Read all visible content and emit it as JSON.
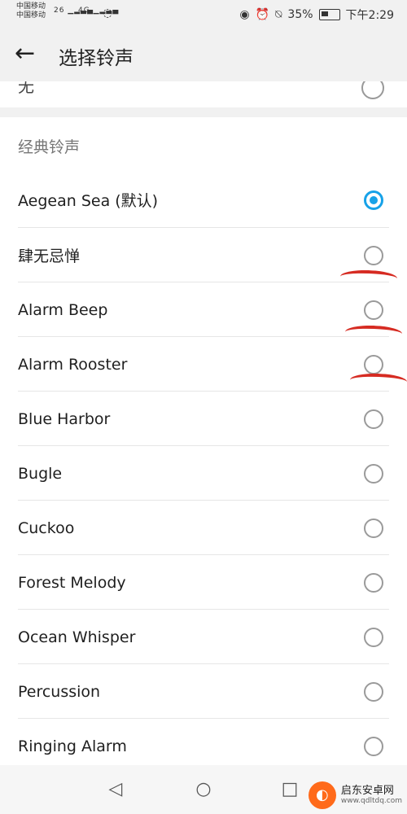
{
  "status": {
    "carrier1": "中国移动",
    "carrier2": "中国移动",
    "net1": "26",
    "net2": "4G",
    "battery": "35%",
    "time": "下午2:29"
  },
  "topbar": {
    "title": "选择铃声"
  },
  "none_option": {
    "label": "无"
  },
  "section": {
    "title": "经典铃声"
  },
  "ringtones": [
    {
      "label": "Aegean Sea (默认)",
      "selected": true
    },
    {
      "label": "肆无忌惮",
      "selected": false
    },
    {
      "label": "Alarm Beep",
      "selected": false
    },
    {
      "label": "Alarm Rooster",
      "selected": false
    },
    {
      "label": "Blue Harbor",
      "selected": false
    },
    {
      "label": "Bugle",
      "selected": false
    },
    {
      "label": "Cuckoo",
      "selected": false
    },
    {
      "label": "Forest Melody",
      "selected": false
    },
    {
      "label": "Ocean Whisper",
      "selected": false
    },
    {
      "label": "Percussion",
      "selected": false
    },
    {
      "label": "Ringing Alarm",
      "selected": false
    }
  ],
  "icons": {
    "back": "arrow-left-icon",
    "eye": "eye-icon",
    "alarm": "alarm-icon",
    "mute": "bell-off-icon",
    "battery": "battery-icon",
    "nav_back": "triangle-back-icon",
    "nav_home": "circle-home-icon",
    "nav_recent": "square-recent-icon"
  },
  "watermark": {
    "name": "启东安卓网",
    "url": "www.qdltdq.com"
  },
  "colors": {
    "accent": "#17a2e8",
    "scribble": "#d62b22"
  }
}
